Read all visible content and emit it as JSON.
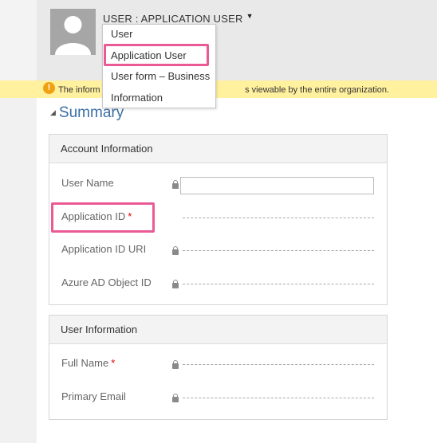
{
  "header": {
    "form_selector_label": "USER : APPLICATION USER",
    "caret": "▼"
  },
  "dropdown": {
    "items": [
      "User",
      "Application User",
      "User form – Business",
      "Information"
    ],
    "selected_index": 1
  },
  "notification": {
    "icon": "warning-icon",
    "text_start": "The inform",
    "text_end": "s viewable by the entire organization."
  },
  "summary": {
    "title": "Summary"
  },
  "account_section": {
    "heading": "Account Information",
    "fields": {
      "user_name": "User Name",
      "application_id": "Application ID",
      "application_id_uri": "Application ID URI",
      "azure_ad_object_id": "Azure AD Object ID"
    }
  },
  "user_section": {
    "heading": "User Information",
    "fields": {
      "full_name": "Full Name",
      "primary_email": "Primary Email"
    }
  },
  "required_marker": "*",
  "colors": {
    "highlight": "#ea5a95",
    "link_blue": "#3a6ea5",
    "notify_bg": "#fff19e",
    "required": "#dd0000"
  }
}
